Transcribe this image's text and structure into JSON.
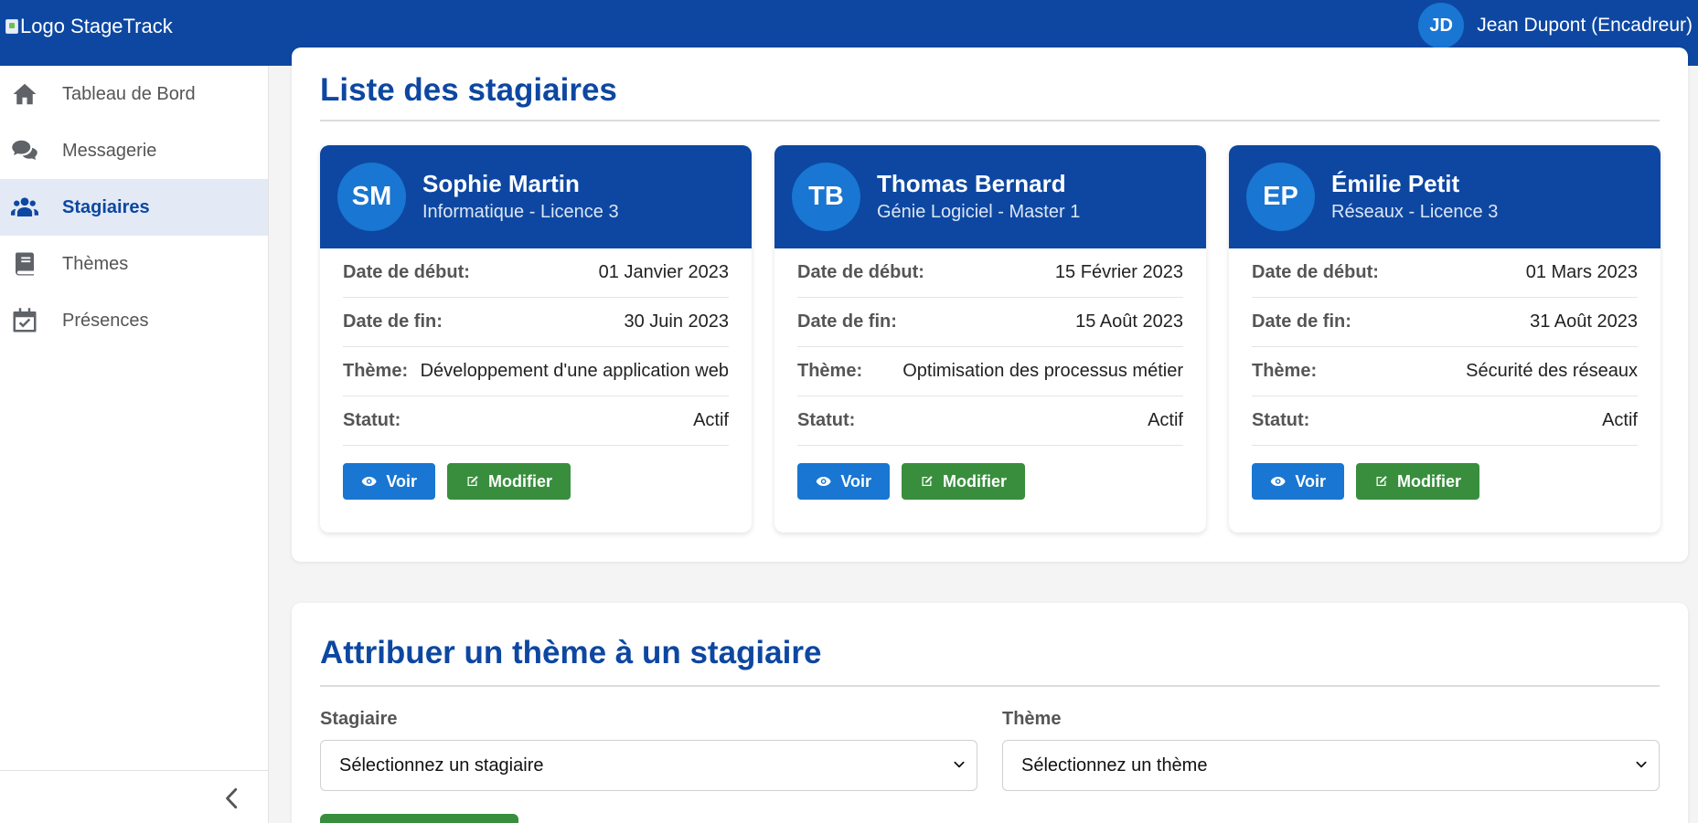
{
  "header": {
    "logo_alt": "Logo StageTrack",
    "user_initials": "JD",
    "user_name": "Jean Dupont (Encadreur)"
  },
  "sidebar": {
    "items": [
      {
        "label": "Tableau de Bord",
        "icon": "home-icon"
      },
      {
        "label": "Messagerie",
        "icon": "chat-icon"
      },
      {
        "label": "Stagiaires",
        "icon": "users-icon",
        "active": true
      },
      {
        "label": "Thèmes",
        "icon": "book-icon"
      },
      {
        "label": "Présences",
        "icon": "calendar-check-icon"
      }
    ],
    "collapse_icon": "chevron-left-icon"
  },
  "interns_section": {
    "title": "Liste des stagiaires",
    "labels": {
      "start": "Date de début:",
      "end": "Date de fin:",
      "theme": "Thème:",
      "status": "Statut:",
      "view": "Voir",
      "edit": "Modifier"
    },
    "cards": [
      {
        "initials": "SM",
        "name": "Sophie Martin",
        "program": "Informatique - Licence 3",
        "start": "01 Janvier 2023",
        "end": "30 Juin 2023",
        "theme": "Développement d'une application web",
        "status": "Actif"
      },
      {
        "initials": "TB",
        "name": "Thomas Bernard",
        "program": "Génie Logiciel - Master 1",
        "start": "15 Février 2023",
        "end": "15 Août 2023",
        "theme": "Optimisation des processus métier",
        "status": "Actif"
      },
      {
        "initials": "EP",
        "name": "Émilie Petit",
        "program": "Réseaux - Licence 3",
        "start": "01 Mars 2023",
        "end": "31 Août 2023",
        "theme": "Sécurité des réseaux",
        "status": "Actif"
      }
    ]
  },
  "assign_section": {
    "title": "Attribuer un thème à un stagiaire",
    "intern_label": "Stagiaire",
    "intern_selected": "Sélectionnez un stagiaire",
    "theme_label": "Thème",
    "theme_selected": "Sélectionnez un thème"
  },
  "colors": {
    "primary": "#0d47a1",
    "accent": "#1976d2",
    "success": "#388e3c",
    "active_bg": "#e3eaf5"
  }
}
